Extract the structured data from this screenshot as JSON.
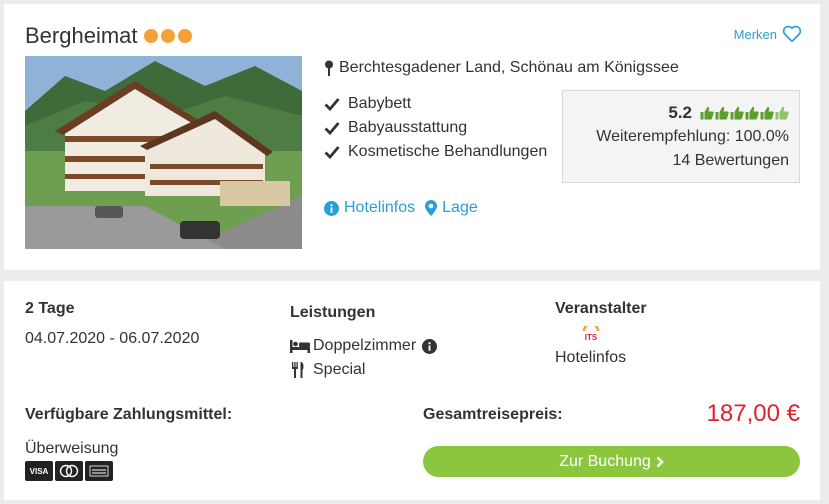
{
  "hotel": {
    "name": "Bergheimat",
    "stars": 3,
    "star_color": "#f5a13b",
    "bookmark_label": "Merken",
    "location": "Berchtesgadener Land, Schönau am Königssee",
    "features": [
      "Babybett",
      "Babyausstattung",
      "Kosmetische Behandlungen"
    ],
    "links": {
      "info": "Hotelinfos",
      "location": "Lage"
    },
    "rating": {
      "score": "5.2",
      "thumbs_total": 6,
      "score_max": 6,
      "recommendation": "Weiterempfehlung: 100.0%",
      "reviews": "14 Bewertungen"
    }
  },
  "booking": {
    "duration": "2 Tage",
    "dates": "04.07.2020 - 06.07.2020",
    "services_title": "Leistungen",
    "room": "Doppelzimmer",
    "board": "Special",
    "operator_title": "Veranstalter",
    "operator_logo": "ITS",
    "operator_link": "Hotelinfos",
    "payment_title": "Verfügbare Zahlungsmittel:",
    "payment_method": "Überweisung",
    "payment_cards": [
      "VISA",
      "Mastercard",
      "American Express"
    ],
    "total_label": "Gesamtreisepreis:",
    "total_price": "187,00 €",
    "cta_label": "Zur Buchung"
  },
  "colors": {
    "accent": "#2a9fd6",
    "price": "#e2202c",
    "cta": "#8cc63f",
    "rating_green": "#5a9e2c"
  }
}
